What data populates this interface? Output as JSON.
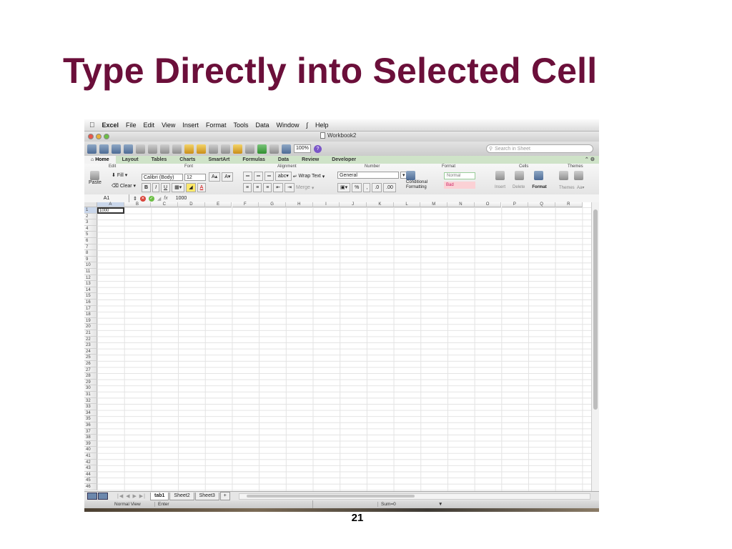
{
  "slide": {
    "title": "Type Directly into Selected Cell",
    "page_number": "21"
  },
  "menubar": {
    "app": "Excel",
    "items": [
      "File",
      "Edit",
      "View",
      "Insert",
      "Format",
      "Tools",
      "Data",
      "Window",
      "Help"
    ]
  },
  "window": {
    "title": "Workbook2"
  },
  "toolbar": {
    "zoom": "100%",
    "search_placeholder": "Search in Sheet"
  },
  "ribbon_tabs": [
    "Home",
    "Layout",
    "Tables",
    "Charts",
    "SmartArt",
    "Formulas",
    "Data",
    "Review",
    "Developer"
  ],
  "ribbon": {
    "groups": {
      "edit": "Edit",
      "font": "Font",
      "alignment": "Alignment",
      "number": "Number",
      "format": "Format",
      "cells": "Cells",
      "themes": "Themes"
    },
    "paste": "Paste",
    "fill": "Fill",
    "clear": "Clear",
    "font_name": "Calibri (Body)",
    "font_size": "12",
    "bold": "B",
    "italic": "I",
    "underline": "U",
    "wrap_text": "Wrap Text",
    "merge": "Merge",
    "number_format": "General",
    "conditional_formatting": "Conditional Formatting",
    "style_normal": "Normal",
    "style_bad": "Bad",
    "insert": "Insert",
    "delete": "Delete",
    "format_btn": "Format",
    "themes_btn": "Themes"
  },
  "formula_bar": {
    "name_box": "A1",
    "fx": "fx",
    "value": "1000"
  },
  "grid": {
    "columns": [
      "A",
      "B",
      "C",
      "D",
      "E",
      "F",
      "G",
      "H",
      "I",
      "J",
      "K",
      "L",
      "M",
      "N",
      "O",
      "P",
      "Q",
      "R"
    ],
    "row_count": 46,
    "selected_cell_value": "1000"
  },
  "sheets": [
    "tab1",
    "Sheet2",
    "Sheet3"
  ],
  "status": {
    "view": "Normal View",
    "mode": "Enter",
    "sum": "Sum=0"
  }
}
